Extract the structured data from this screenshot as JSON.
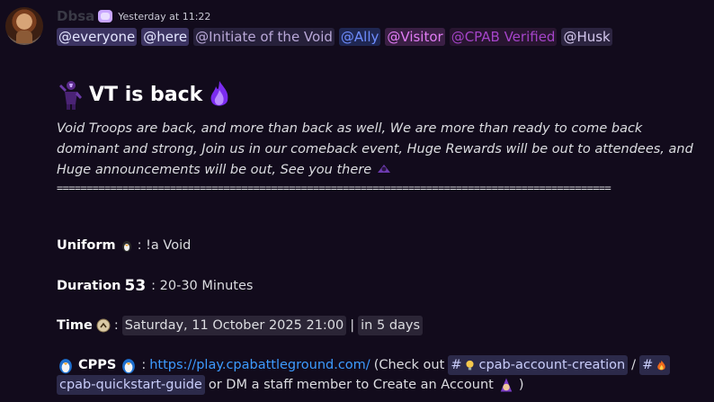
{
  "message": {
    "author": "Dbsa",
    "timestamp": "Yesterday at 11:22",
    "mentions": [
      "@everyone",
      "@here",
      "@Initiate of the Void",
      "@Ally",
      "@Visitor",
      "@CPAB Verified",
      "@Husk"
    ],
    "title": "VT is back",
    "description": "Void Troops are back, and more than back as well, We are more than ready to come back dominant and strong, Join us in our comeback event, Huge Rewards will be out to attendees, and Huge announcements will be out, See you there",
    "separator": "=============================================================================================",
    "uniform": {
      "label": "Uniform",
      "value": ": !a Void"
    },
    "duration": {
      "label": "Duration",
      "number": "53",
      "value": ": 20-30 Minutes"
    },
    "time": {
      "label": "Time",
      "colon": ":",
      "date": "Saturday, 11 October 2025 21:00",
      "divider": "|",
      "relative": "in 5 days"
    },
    "cpps": {
      "label": "CPPS",
      "colon": ":",
      "url": "https://play.cpabattleground.com/",
      "check_text": "(Check out",
      "channel1_sep": "#",
      "channel1": "cpab-account-creation",
      "slash": "/",
      "channel2_sep": "#",
      "channel2": "cpab-quickstart-guide",
      "tail": "or DM a staff member to Create an Account",
      "close": ")"
    }
  },
  "colors": {
    "background": "#120b1c",
    "link": "#3d9bff",
    "ally": "#6f8dff",
    "visitor": "#e07cf4",
    "cpab_verified": "#a544c9"
  }
}
